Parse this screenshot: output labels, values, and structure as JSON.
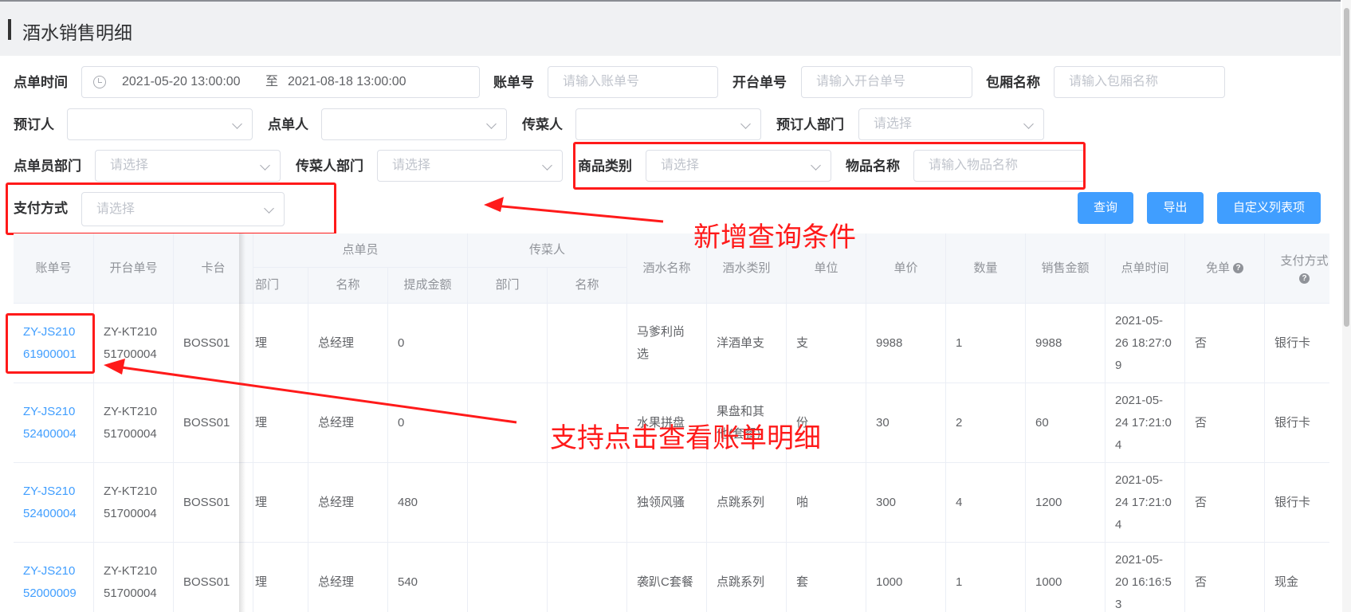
{
  "page": {
    "title": "酒水销售明细"
  },
  "filters": {
    "order_time_label": "点单时间",
    "date_start": "2021-05-20 13:00:00",
    "date_sep": "至",
    "date_end": "2021-08-18 13:00:00",
    "bill_no_label": "账单号",
    "bill_no_placeholder": "请输入账单号",
    "open_no_label": "开台单号",
    "open_no_placeholder": "请输入开台单号",
    "room_label": "包厢名称",
    "room_placeholder": "请输入包厢名称",
    "booker_label": "预订人",
    "orderer_label": "点单人",
    "server_label": "传菜人",
    "booker_dept_label": "预订人部门",
    "booker_dept_placeholder": "请选择",
    "orderer_dept_label": "点单员部门",
    "orderer_dept_placeholder": "请选择",
    "server_dept_label": "传菜人部门",
    "server_dept_placeholder": "请选择",
    "category_label": "商品类别",
    "category_placeholder": "请选择",
    "item_label": "物品名称",
    "item_placeholder": "请输入物品名称",
    "payment_label": "支付方式",
    "payment_placeholder": "请选择"
  },
  "buttons": {
    "query": "查询",
    "export": "导出",
    "custom_columns": "自定义列表项"
  },
  "annotations": {
    "new_filters": "新增查询条件",
    "click_bill": "支持点击查看账单明细"
  },
  "table": {
    "headers": {
      "bill_no": "账单号",
      "open_no": "开台单号",
      "table": "卡台",
      "orderer_group": "点单员",
      "dept_partial": "部门",
      "name": "名称",
      "commission": "提成金额",
      "server_group": "传菜人",
      "server_dept": "部门",
      "server_name": "名称",
      "drink_name": "酒水名称",
      "drink_type": "酒水类别",
      "unit": "单位",
      "price": "单价",
      "qty": "数量",
      "amount": "销售金额",
      "time": "点单时间",
      "free": "免单",
      "payment": "支付方式"
    },
    "rows": [
      {
        "bill1": "ZY-JS210",
        "bill2": "61900001",
        "open1": "ZY-KT210",
        "open2": "51700004",
        "table": "BOSS01",
        "dept": "理",
        "name": "总经理",
        "commission": "0",
        "server_dept": "",
        "server_name": "",
        "drink1": "马爹利尚",
        "drink2": "选",
        "type1": "洋酒单支",
        "type2": "",
        "unit": "支",
        "price": "9988",
        "qty": "1",
        "amount": "9988",
        "time1": "2021-05-",
        "time2": "26 18:27:0",
        "time3": "9",
        "free": "否",
        "payment": "银行卡"
      },
      {
        "bill1": "ZY-JS210",
        "bill2": "52400004",
        "open1": "ZY-KT210",
        "open2": "51700004",
        "table": "BOSS01",
        "dept": "理",
        "name": "总经理",
        "commission": "0",
        "server_dept": "",
        "server_name": "",
        "drink1": "水果拼盘",
        "drink2": "",
        "type1": "果盘和其",
        "type2": "他(套餐)",
        "unit": "份",
        "price": "30",
        "qty": "2",
        "amount": "60",
        "time1": "2021-05-",
        "time2": "24 17:21:0",
        "time3": "4",
        "free": "否",
        "payment": "银行卡"
      },
      {
        "bill1": "ZY-JS210",
        "bill2": "52400004",
        "open1": "ZY-KT210",
        "open2": "51700004",
        "table": "BOSS01",
        "dept": "理",
        "name": "总经理",
        "commission": "480",
        "server_dept": "",
        "server_name": "",
        "drink1": "独领风骚",
        "drink2": "",
        "type1": "点跳系列",
        "type2": "",
        "unit": "啪",
        "price": "300",
        "qty": "4",
        "amount": "1200",
        "time1": "2021-05-",
        "time2": "24 17:21:0",
        "time3": "4",
        "free": "否",
        "payment": "银行卡"
      },
      {
        "bill1": "ZY-JS210",
        "bill2": "52000009",
        "open1": "ZY-KT210",
        "open2": "51700004",
        "table": "BOSS01",
        "dept": "理",
        "name": "总经理",
        "commission": "540",
        "server_dept": "",
        "server_name": "",
        "drink1": "袭趴C套餐",
        "drink2": "",
        "type1": "点跳系列",
        "type2": "",
        "unit": "套",
        "price": "1000",
        "qty": "1",
        "amount": "1000",
        "time1": "2021-05-",
        "time2": "20 16:16:5",
        "time3": "3",
        "free": "否",
        "payment": "现金"
      }
    ]
  }
}
